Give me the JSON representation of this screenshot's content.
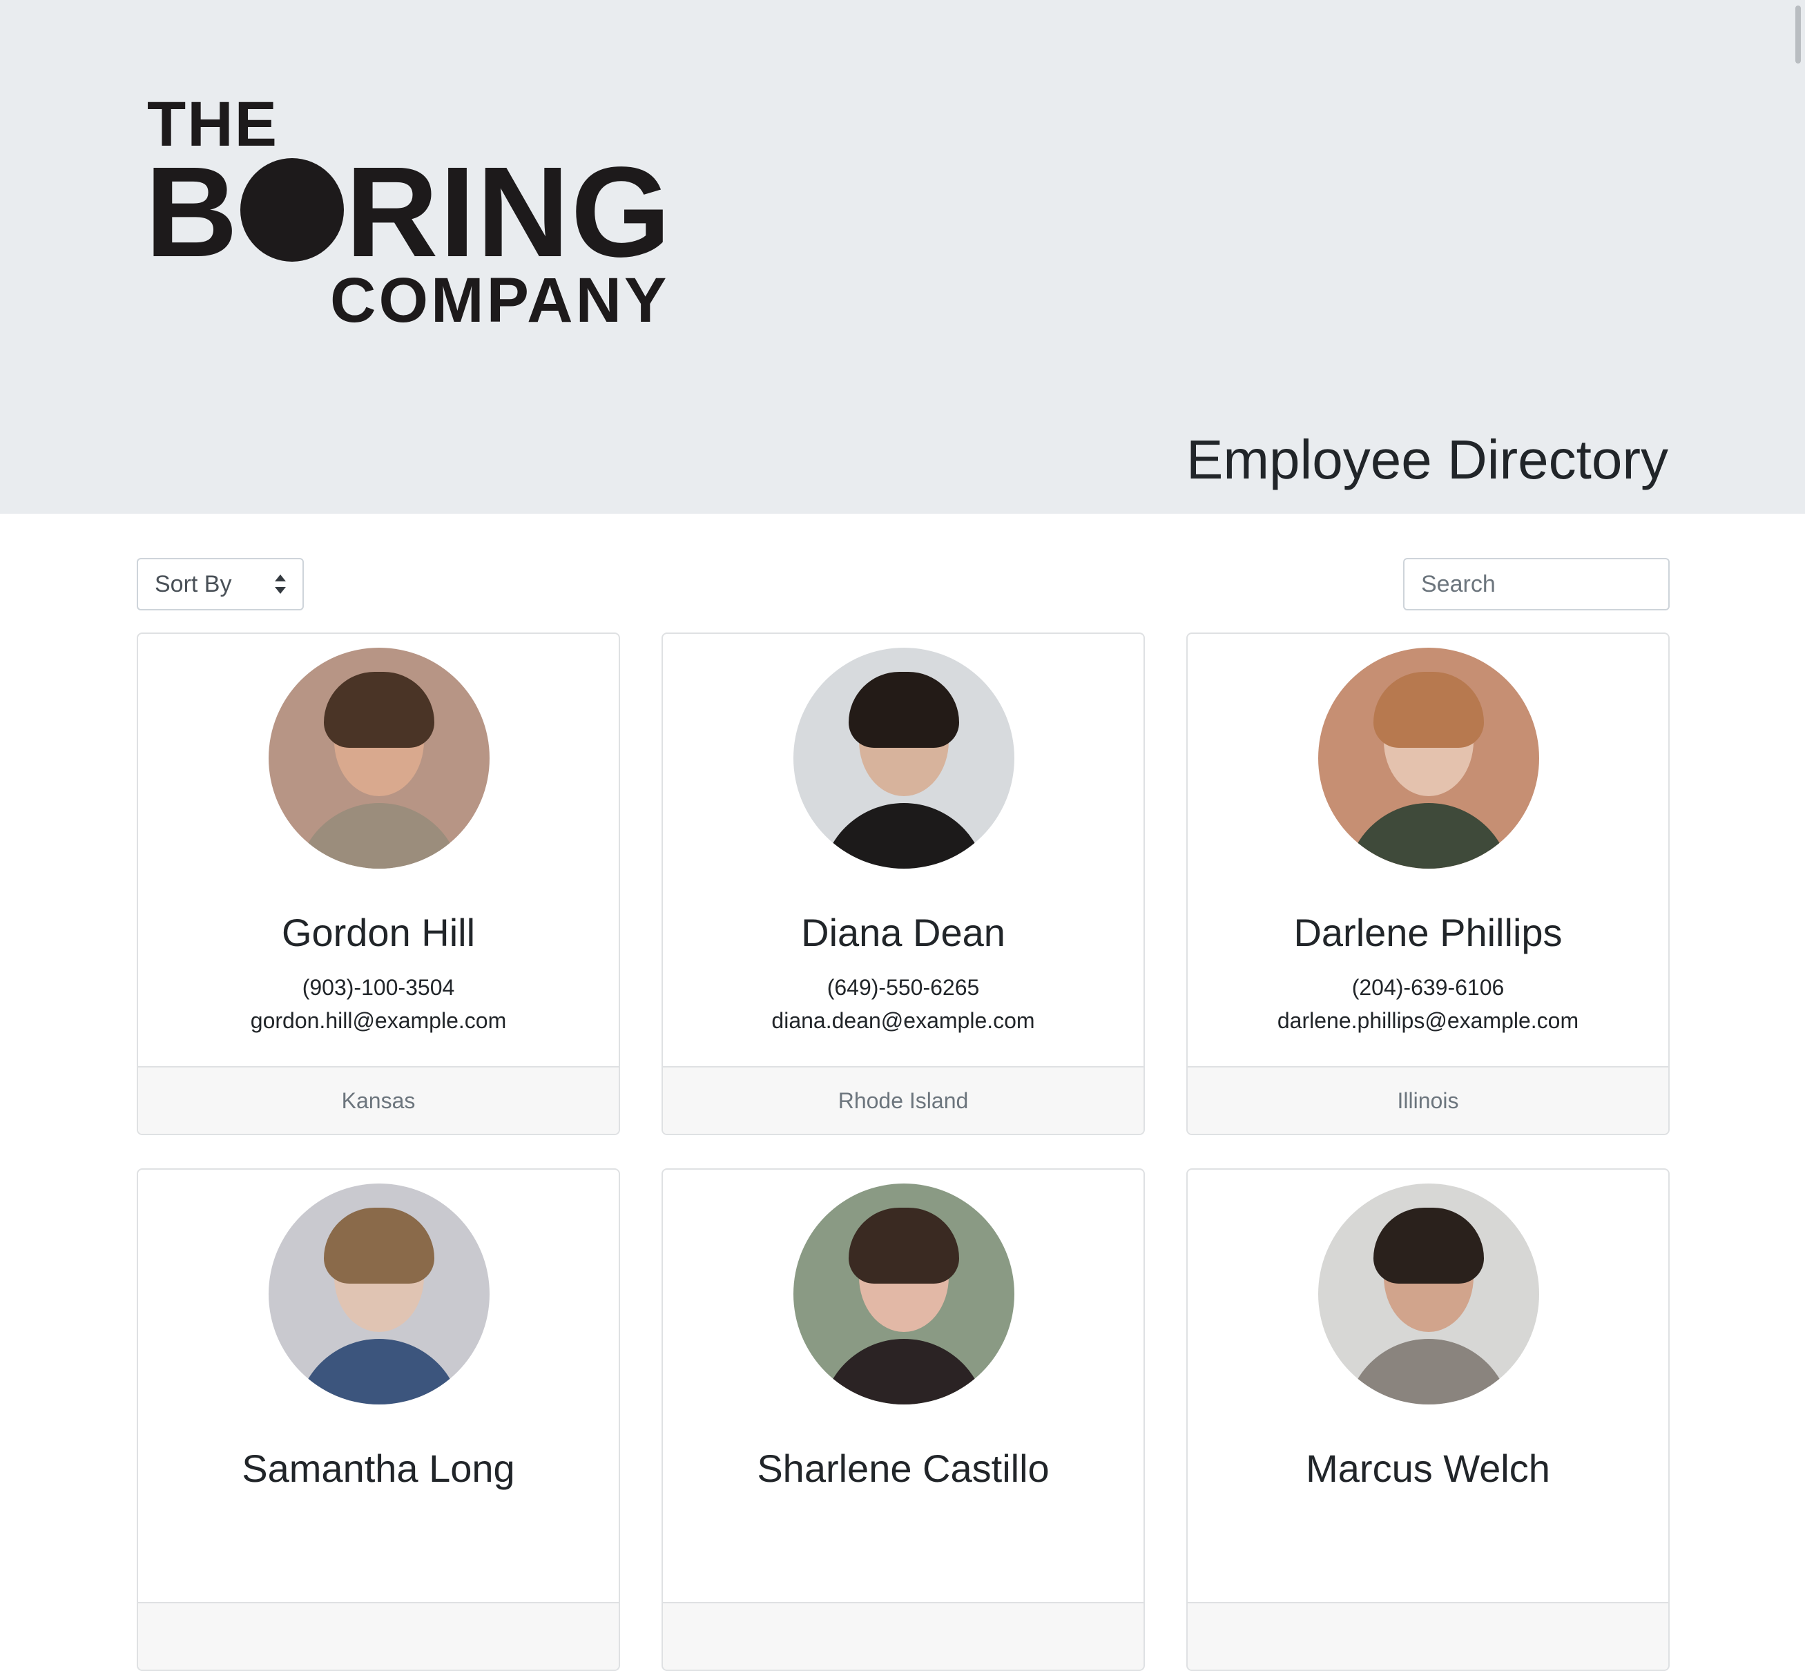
{
  "header": {
    "logo": {
      "line1": "THE",
      "line2_before": "B",
      "line2_after": "RING",
      "line3": "COMPANY"
    },
    "title": "Employee Directory"
  },
  "controls": {
    "sort_label": "Sort By",
    "search_placeholder": "Search"
  },
  "employees": [
    {
      "name": "Gordon Hill",
      "phone": "(903)-100-3504",
      "email": "gordon.hill@example.com",
      "location": "Kansas",
      "avatar": {
        "bg": "#b79585",
        "skin": "#d9a98e",
        "hair": "#4a3426",
        "shirt": "#9b8d7c"
      }
    },
    {
      "name": "Diana Dean",
      "phone": "(649)-550-6265",
      "email": "diana.dean@example.com",
      "location": "Rhode Island",
      "avatar": {
        "bg": "#d7dadd",
        "skin": "#d7b39c",
        "hair": "#231b17",
        "shirt": "#1c1a1a"
      }
    },
    {
      "name": "Darlene Phillips",
      "phone": "(204)-639-6106",
      "email": "darlene.phillips@example.com",
      "location": "Illinois",
      "avatar": {
        "bg": "#c68f73",
        "skin": "#e4c2ae",
        "hair": "#b7794f",
        "shirt": "#3f4a3a"
      }
    },
    {
      "name": "Samantha Long",
      "phone": "",
      "email": "",
      "location": "",
      "avatar": {
        "bg": "#c9c9cf",
        "skin": "#e0c4b3",
        "hair": "#8a6a4a",
        "shirt": "#3c557d"
      }
    },
    {
      "name": "Sharlene Castillo",
      "phone": "",
      "email": "",
      "location": "",
      "avatar": {
        "bg": "#8a9a84",
        "skin": "#e2b8a6",
        "hair": "#3a2a22",
        "shirt": "#2b2324"
      }
    },
    {
      "name": "Marcus Welch",
      "phone": "",
      "email": "",
      "location": "",
      "avatar": {
        "bg": "#d7d7d5",
        "skin": "#d1a48c",
        "hair": "#2a211c",
        "shirt": "#8a847e"
      }
    }
  ]
}
